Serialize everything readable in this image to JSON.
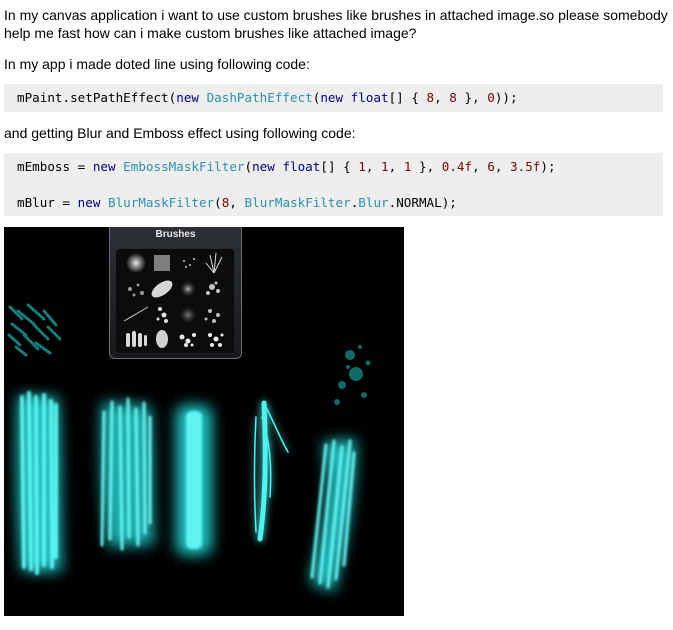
{
  "question": {
    "paragraph1": "In my canvas application i want to use custom brushes like brushes in attached image.so please somebody help me fast how can i make custom brushes like attached image?",
    "paragraph2": "In my app i made doted line using following code:",
    "paragraph3": "and getting Blur and Emboss effect using following code:"
  },
  "code1": {
    "line1": {
      "t1": "mPaint.setPathEffect(",
      "t2": "new",
      "t3": " ",
      "t4": "DashPathEffect",
      "t5": "(",
      "t6": "new",
      "t7": " ",
      "t8": "float",
      "t9": "[] { ",
      "t10": "8",
      "t11": ", ",
      "t12": "8",
      "t13": " }, ",
      "t14": "0",
      "t15": "));"
    }
  },
  "code2": {
    "line1": {
      "t1": "mEmboss = ",
      "t2": "new",
      "t3": " ",
      "t4": "EmbossMaskFilter",
      "t5": "(",
      "t6": "new",
      "t7": " ",
      "t8": "float",
      "t9": "[] { ",
      "t10": "1",
      "t11": ", ",
      "t12": "1",
      "t13": ", ",
      "t14": "1",
      "t15": " }, ",
      "t16": "0.4f",
      "t17": ", ",
      "t18": "6",
      "t19": ", ",
      "t20": "3.5f",
      "t21": ");"
    },
    "line2": {
      "t1": "mBlur = ",
      "t2": "new",
      "t3": " ",
      "t4": "BlurMaskFilter",
      "t5": "(",
      "t6": "8",
      "t7": ", ",
      "t8": "BlurMaskFilter",
      "t9": ".",
      "t10": "Blur",
      "t11": ".NORMAL);"
    }
  },
  "screenshot": {
    "panel_title": "Brushes",
    "stroke_color": "#27e8e8",
    "background_color": "#000000"
  }
}
